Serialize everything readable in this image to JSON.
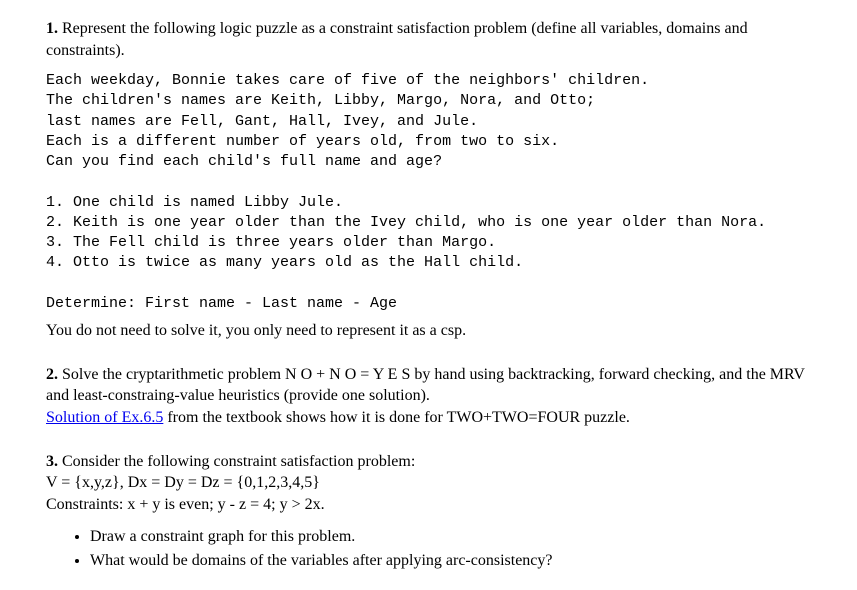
{
  "q1": {
    "number": "1.",
    "prompt_part1": "Represent the following logic puzzle as a constraint satisfaction problem (define all variables, domains and constraints).",
    "block": "Each weekday, Bonnie takes care of five of the neighbors' children.\nThe children's names are Keith, Libby, Margo, Nora, and Otto;\nlast names are Fell, Gant, Hall, Ivey, and Jule.\nEach is a different number of years old, from two to six.\nCan you find each child's full name and age?\n\n1. One child is named Libby Jule.\n2. Keith is one year older than the Ivey child, who is one year older than Nora.\n3. The Fell child is three years older than Margo.\n4. Otto is twice as many years old as the Hall child.\n\nDetermine: First name - Last name - Age",
    "closing": "You do not need to solve it, you only need to represent it as a csp."
  },
  "q2": {
    "number": "2.",
    "prompt_part1": "Solve the cryptarithmetic problem N O + N O = Y E S by hand using backtracking, forward checking, and the MRV and least-constraing-value heuristics (provide one solution).",
    "link_text": "Solution of Ex.6.5",
    "after_link": " from the textbook shows how it is done for TWO+TWO=FOUR puzzle."
  },
  "q3": {
    "number": "3.",
    "line1": "Consider the following constraint satisfaction problem:",
    "line2": "V = {x,y,z}, Dx = Dy = Dz = {0,1,2,3,4,5}",
    "line3": "Constraints: x + y is even; y - z = 4; y > 2x.",
    "bullets": [
      "Draw a constraint graph for this problem.",
      "What would be domains of the variables after applying arc-consistency?"
    ]
  }
}
